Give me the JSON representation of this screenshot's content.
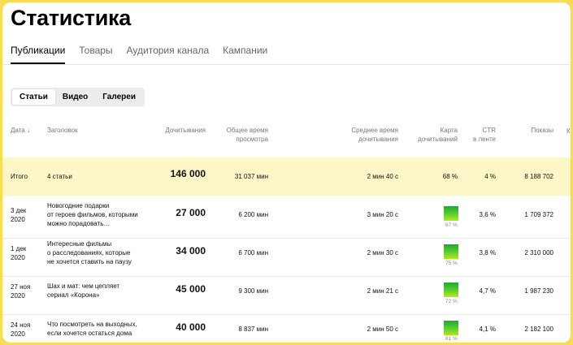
{
  "page_title": "Статистика",
  "tabs": [
    "Публикации",
    "Товары",
    "Аудитория канала",
    "Кампании"
  ],
  "active_tab": 0,
  "content_filter": [
    "Статьи",
    "Видео",
    "Галереи"
  ],
  "active_filter": 0,
  "columns": {
    "date": "Дата ↓",
    "title": "Заголовок",
    "reads": "Дочитывания",
    "total_time_1": "Общее время",
    "total_time_2": "просмотра",
    "avg_time_1": "Среднее время",
    "avg_time_2": "дочитывания",
    "map_1": "Карта",
    "map_2": "дочитываний",
    "ctr_1": "CTR",
    "ctr_2": "в ленте",
    "shows": "Показы",
    "more": "К"
  },
  "total": {
    "label": "Итого",
    "title": "4 статьи",
    "reads": "146 000",
    "total_time": "31 037 мин",
    "avg_time": "2 мин 40 с",
    "map": "68 %",
    "ctr": "4 %",
    "shows": "8 188 702"
  },
  "rows": [
    {
      "date_1": "3 дек",
      "date_2": "2020",
      "title_1": "Новогодние подарки",
      "title_2": "от героев фильмов, которыми",
      "title_3": "можно порадовать…",
      "reads": "27 000",
      "total_time": "6 200 мин",
      "avg_time": "3 мин 20 с",
      "map_pct": "67 %",
      "map_value": 67,
      "ctr": "3,6 %",
      "shows": "1 709 372"
    },
    {
      "date_1": "1 дек",
      "date_2": "2020",
      "title_1": "Интересные фильмы",
      "title_2": "о расследованиях, которые",
      "title_3": "не хочется ставить на паузу",
      "reads": "34 000",
      "total_time": "6 700 мин",
      "avg_time": "2 мин 30 с",
      "map_pct": "75 %",
      "map_value": 75,
      "ctr": "3,8 %",
      "shows": "2 310 000"
    },
    {
      "date_1": "27 ноя",
      "date_2": "2020",
      "title_1": "Шах и мат: чем цепляет",
      "title_2": "сериал «Корона»",
      "title_3": "",
      "reads": "45 000",
      "total_time": "9 300 мин",
      "avg_time": "2 мин 21 с",
      "map_pct": "72 %",
      "map_value": 72,
      "ctr": "4,7 %",
      "shows": "1 987 230"
    },
    {
      "date_1": "24 ноя",
      "date_2": "2020",
      "title_1": "Что посмотреть на выходных,",
      "title_2": "если хочется остаться дома",
      "title_3": "",
      "reads": "40 000",
      "total_time": "8 837 мин",
      "avg_time": "2 мин 50 с",
      "map_pct": "61 %",
      "map_value": 61,
      "ctr": "4,1 %",
      "shows": "2 182 100"
    }
  ]
}
